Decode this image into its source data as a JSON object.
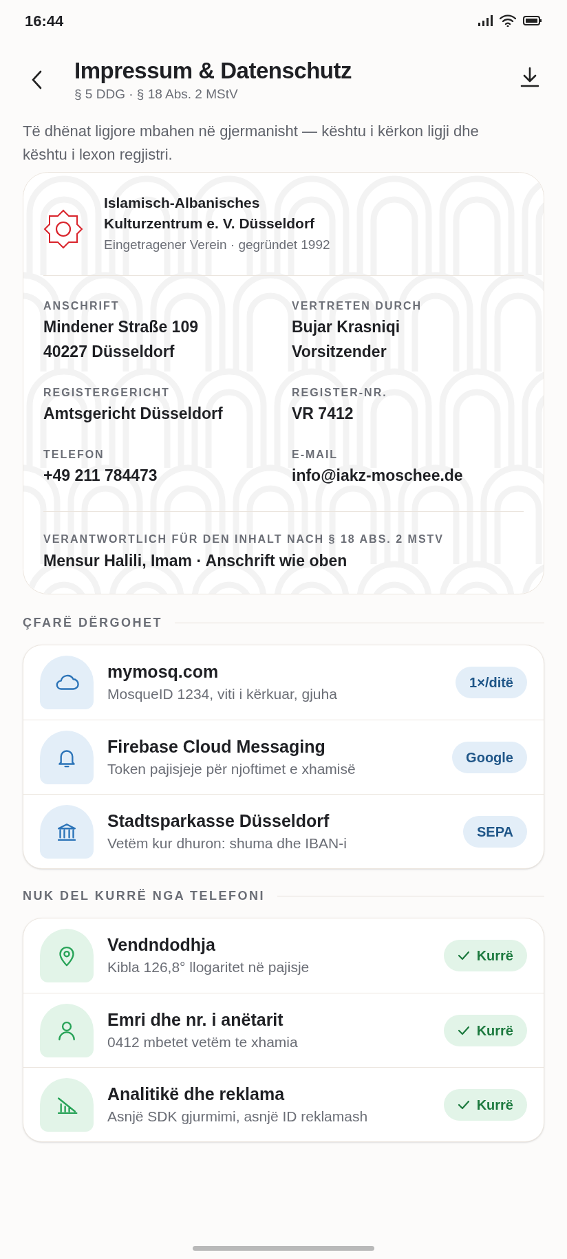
{
  "status_bar": {
    "time": "16:44"
  },
  "header": {
    "title": "Impressum & Datenschutz",
    "subtitle": "§ 5 DDG · § 18 Abs. 2 MStV"
  },
  "intro": "Të dhënat ligjore mbahen në gjermanisht — kështu i kërkon ligji dhe kështu i lexon regjistri.",
  "org": {
    "name": "Islamisch-Albanisches Kulturzentrum e. V. Düsseldorf",
    "tagline": "Eingetragener Verein · gegründet 1992",
    "fields": [
      {
        "label": "ANSCHRIFT",
        "lines": [
          "Mindener Straße 109",
          "40227 Düsseldorf"
        ]
      },
      {
        "label": "VERTRETEN DURCH",
        "lines": [
          "Bujar Krasniqi",
          "Vorsitzender"
        ]
      },
      {
        "label": "REGISTERGERICHT",
        "lines": [
          "Amtsgericht Düsseldorf"
        ]
      },
      {
        "label": "REGISTER-NR.",
        "lines": [
          "VR 7412"
        ]
      },
      {
        "label": "TELEFON",
        "lines": [
          "+49 211 784473"
        ]
      },
      {
        "label": "E-MAIL",
        "lines": [
          "info@iakz-moschee.de"
        ]
      }
    ],
    "responsible": {
      "label": "VERANTWORTLICH FÜR DEN INHALT NACH § 18 ABS. 2 MSTV",
      "value": "Mensur Halili, Imam · Anschrift wie oben"
    }
  },
  "sections": [
    {
      "title": "ÇFARË DËRGOHET",
      "kind": "sent",
      "items": [
        {
          "kind": "cloud",
          "title": "mymosq.com",
          "subtitle": "MosqueID 1234, viti i kërkuar, gjuha",
          "badge": "1×/ditë"
        },
        {
          "kind": "bell",
          "title": "Firebase Cloud Messaging",
          "subtitle": "Token pajisjeje për njoftimet e xhamisë",
          "badge": "Google"
        },
        {
          "kind": "bank",
          "title": "Stadtsparkasse Düsseldorf",
          "subtitle": "Vetëm kur dhuron: shuma dhe IBAN-i",
          "badge": "SEPA"
        }
      ]
    },
    {
      "title": "NUK DEL KURRË NGA TELEFONI",
      "kind": "local",
      "items": [
        {
          "kind": "pin",
          "title": "Vendndodhja",
          "subtitle": "Kibla 126,8° llogaritet në pajisje",
          "badge": "Kurrë"
        },
        {
          "kind": "person",
          "title": "Emri dhe nr. i anëtarit",
          "subtitle": "0412 mbetet vetëm te xhamia",
          "badge": "Kurrë"
        },
        {
          "kind": "chart",
          "title": "Analitikë dhe reklama",
          "subtitle": "Asnjë SDK gjurmimi, asnjë ID reklamash",
          "badge": "Kurrë"
        }
      ]
    }
  ]
}
